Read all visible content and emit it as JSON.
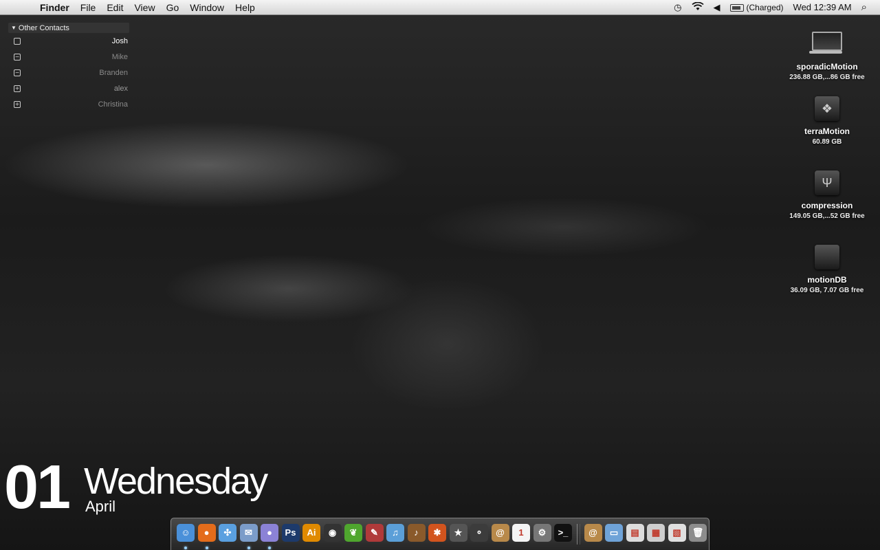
{
  "menubar": {
    "app_name": "Finder",
    "menus": [
      "File",
      "Edit",
      "View",
      "Go",
      "Window",
      "Help"
    ],
    "battery_status": "(Charged)",
    "clock": "Wed 12:39 AM"
  },
  "contacts": {
    "group_title": "Other Contacts",
    "items": [
      {
        "name": "Josh",
        "status_symbol": "",
        "color": "#ffffff"
      },
      {
        "name": "Mike",
        "status_symbol": "−",
        "color": "#8a8a8a"
      },
      {
        "name": "Branden",
        "status_symbol": "−",
        "color": "#8a8a8a"
      },
      {
        "name": "alex",
        "status_symbol": "+",
        "color": "#9a9a9a"
      },
      {
        "name": "Christina",
        "status_symbol": "+",
        "color": "#8a8a8a"
      }
    ]
  },
  "desktop_icons": [
    {
      "name": "sporadicMotion",
      "info": "236.88 GB,...86 GB free",
      "icon": "laptop-drive-icon"
    },
    {
      "name": "terraMotion",
      "info": "60.89 GB",
      "icon": "bootcamp-drive-icon"
    },
    {
      "name": "compression",
      "info": "149.05 GB,...52 GB free",
      "icon": "usb-drive-icon"
    },
    {
      "name": "motionDB",
      "info": "36.09 GB, 7.07 GB free",
      "icon": "external-drive-icon"
    }
  ],
  "date_widget": {
    "day": "01",
    "weekday": "Wednesday",
    "month": "April"
  },
  "dock": {
    "apps": [
      {
        "icon": "finder-icon",
        "glyph": "☺",
        "bg": "#4a90d9",
        "running": true
      },
      {
        "icon": "firefox-icon",
        "glyph": "●",
        "bg": "#e46c1b",
        "running": true
      },
      {
        "icon": "safari-icon",
        "glyph": "✣",
        "bg": "#5aa0e0",
        "running": false
      },
      {
        "icon": "mail-icon",
        "glyph": "✉",
        "bg": "#7b9cc9",
        "running": true
      },
      {
        "icon": "adium-icon",
        "glyph": "●",
        "bg": "#8b82d6",
        "running": true
      },
      {
        "icon": "photoshop-icon",
        "glyph": "Ps",
        "bg": "#1d3a6b",
        "running": false
      },
      {
        "icon": "illustrator-icon",
        "glyph": "Ai",
        "bg": "#e08a00",
        "running": false
      },
      {
        "icon": "aperture-icon",
        "glyph": "◉",
        "bg": "#333333",
        "running": false
      },
      {
        "icon": "coda-icon",
        "glyph": "❦",
        "bg": "#4fa62e",
        "running": false
      },
      {
        "icon": "textmate-icon",
        "glyph": "✎",
        "bg": "#b03a3a",
        "running": false
      },
      {
        "icon": "itunes-icon",
        "glyph": "♫",
        "bg": "#5b9fd8",
        "running": false
      },
      {
        "icon": "garageband-icon",
        "glyph": "♪",
        "bg": "#8a5a2b",
        "running": false
      },
      {
        "icon": "reason-icon",
        "glyph": "✱",
        "bg": "#d2541e",
        "running": false
      },
      {
        "icon": "imovie-icon",
        "glyph": "★",
        "bg": "#555555",
        "running": false
      },
      {
        "icon": "transmission-icon",
        "glyph": "⚬",
        "bg": "#3c3c3c",
        "running": false
      },
      {
        "icon": "address-book-icon",
        "glyph": "@",
        "bg": "#b8894a",
        "running": false
      },
      {
        "icon": "ical-icon",
        "glyph": "1",
        "bg": "#f4f4f4",
        "running": false
      },
      {
        "icon": "system-preferences-icon",
        "glyph": "⚙",
        "bg": "#777777",
        "running": false
      },
      {
        "icon": "terminal-icon",
        "glyph": ">_",
        "bg": "#111111",
        "running": false
      }
    ],
    "stacks": [
      {
        "icon": "address-folder-icon",
        "glyph": "@",
        "bg": "#b8894a"
      },
      {
        "icon": "folder-icon",
        "glyph": "▭",
        "bg": "#6fa3d8"
      },
      {
        "icon": "document-icon",
        "glyph": "▤",
        "bg": "#dddddd"
      },
      {
        "icon": "screenshot-stack-icon",
        "glyph": "▦",
        "bg": "#cfcfcf"
      },
      {
        "icon": "downloads-stack-icon",
        "glyph": "▧",
        "bg": "#e0e0e0"
      },
      {
        "icon": "trash-icon",
        "glyph": "🗑",
        "bg": "#8c8c8c"
      }
    ]
  }
}
